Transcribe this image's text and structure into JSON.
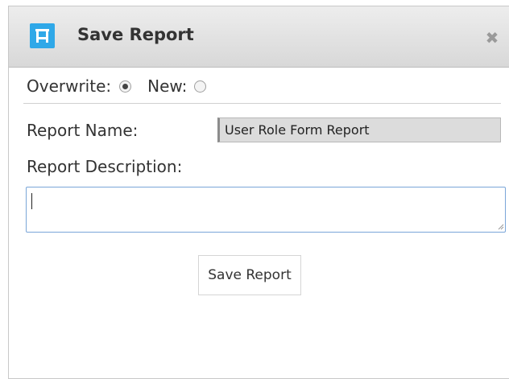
{
  "dialog": {
    "title": "Save Report",
    "close_glyph": "✖",
    "icon": "report-app-icon",
    "accent_color": "#2fa8e8"
  },
  "mode": {
    "overwrite_label": "Overwrite:",
    "new_label": "New:",
    "selected": "overwrite"
  },
  "form": {
    "report_name_label": "Report Name:",
    "report_name_value": "User Role Form Report",
    "report_description_label": "Report Description:",
    "report_description_value": ""
  },
  "actions": {
    "save_label": "Save Report"
  }
}
